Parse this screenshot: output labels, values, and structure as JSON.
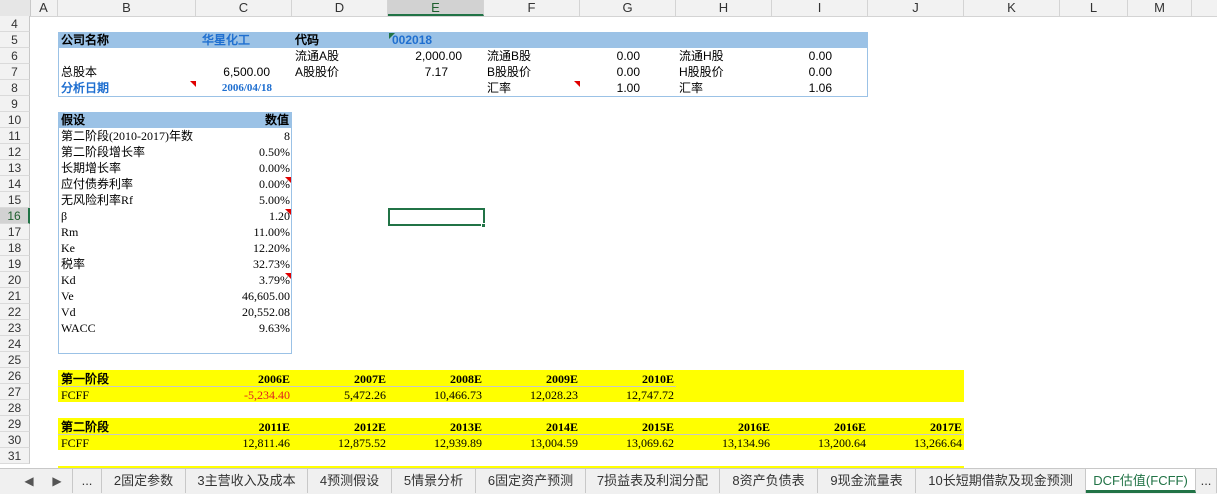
{
  "columns": [
    "A",
    "B",
    "C",
    "D",
    "E",
    "F",
    "G",
    "H",
    "I",
    "J",
    "K",
    "L",
    "M"
  ],
  "selected_column": "E",
  "rows": [
    "4",
    "5",
    "6",
    "7",
    "8",
    "9",
    "10",
    "11",
    "12",
    "13",
    "14",
    "15",
    "16",
    "17",
    "18",
    "19",
    "20",
    "21",
    "22",
    "23",
    "24",
    "25",
    "26",
    "27",
    "28",
    "29",
    "30",
    "31"
  ],
  "selected_row": "16",
  "company": {
    "name_label": "公司名称",
    "name_value": "华星化工",
    "code_label": "代码",
    "code_value": "002018",
    "a_float_label": "流通A股",
    "a_float_value": "2,000.00",
    "b_float_label": "流通B股",
    "b_float_value": "0.00",
    "h_float_label": "流通H股",
    "h_float_value": "0.00",
    "total_shares_label": "总股本",
    "total_shares_value": "6,500.00",
    "a_price_label": "A股股价",
    "a_price_value": "7.17",
    "b_price_label": "B股股价",
    "b_price_value": "0.00",
    "h_price_label": "H股股价",
    "h_price_value": "0.00",
    "date_label": "分析日期",
    "date_value": "2006/04/18",
    "fx_b_label": "汇率",
    "fx_b_value": "1.00",
    "fx_h_label": "汇率",
    "fx_h_value": "1.06"
  },
  "assumptions": {
    "header_label": "假设",
    "header_value": "数值",
    "items": [
      {
        "label": "第二阶段(2010-2017)年数",
        "value": "8"
      },
      {
        "label": "第二阶段增长率",
        "value": "0.50%"
      },
      {
        "label": "长期增长率",
        "value": "0.00%"
      },
      {
        "label": "应付债券利率",
        "value": "0.00%"
      },
      {
        "label": "无风险利率Rf",
        "value": "5.00%"
      },
      {
        "label": "β",
        "value": "1.20"
      },
      {
        "label": "Rm",
        "value": "11.00%"
      },
      {
        "label": "Ke",
        "value": "12.20%"
      },
      {
        "label": "税率",
        "value": "32.73%"
      },
      {
        "label": "Kd",
        "value": "3.79%"
      },
      {
        "label": "Ve",
        "value": "46,605.00"
      },
      {
        "label": "Vd",
        "value": "20,552.08"
      },
      {
        "label": "WACC",
        "value": "9.63%"
      }
    ]
  },
  "stage1": {
    "label": "第一阶段",
    "row_label": "FCFF",
    "years": [
      "2006E",
      "2007E",
      "2008E",
      "2009E",
      "2010E"
    ],
    "values": [
      "-5,234.40",
      "5,472.26",
      "10,466.73",
      "12,028.23",
      "12,747.72"
    ]
  },
  "stage2": {
    "label": "第二阶段",
    "row_label": "FCFF",
    "years": [
      "2011E",
      "2012E",
      "2013E",
      "2014E",
      "2015E",
      "2016E",
      "2016E",
      "2017E"
    ],
    "values": [
      "12,811.46",
      "12,875.52",
      "12,939.89",
      "13,004.59",
      "13,069.62",
      "13,134.96",
      "13,200.64",
      "13,266.64"
    ]
  },
  "tabs": {
    "nav_prev": "◀",
    "nav_next": "▶",
    "ellipsis_left": "...",
    "ellipsis_right": "...",
    "items": [
      "2固定参数",
      "3主营收入及成本",
      "4预测假设",
      "5情景分析",
      "6固定资产预测",
      "7损益表及利润分配",
      "8资产负债表",
      "9现金流量表",
      "10长短期借款及现金预测",
      "DCF估值(FCFF)"
    ],
    "active": "DCF估值(FCFF)"
  },
  "colors": {
    "yellow": "#ffff00",
    "header_blue": "#9bc2e6",
    "box_border": "#9bc2e6",
    "selection_green": "#217346"
  }
}
